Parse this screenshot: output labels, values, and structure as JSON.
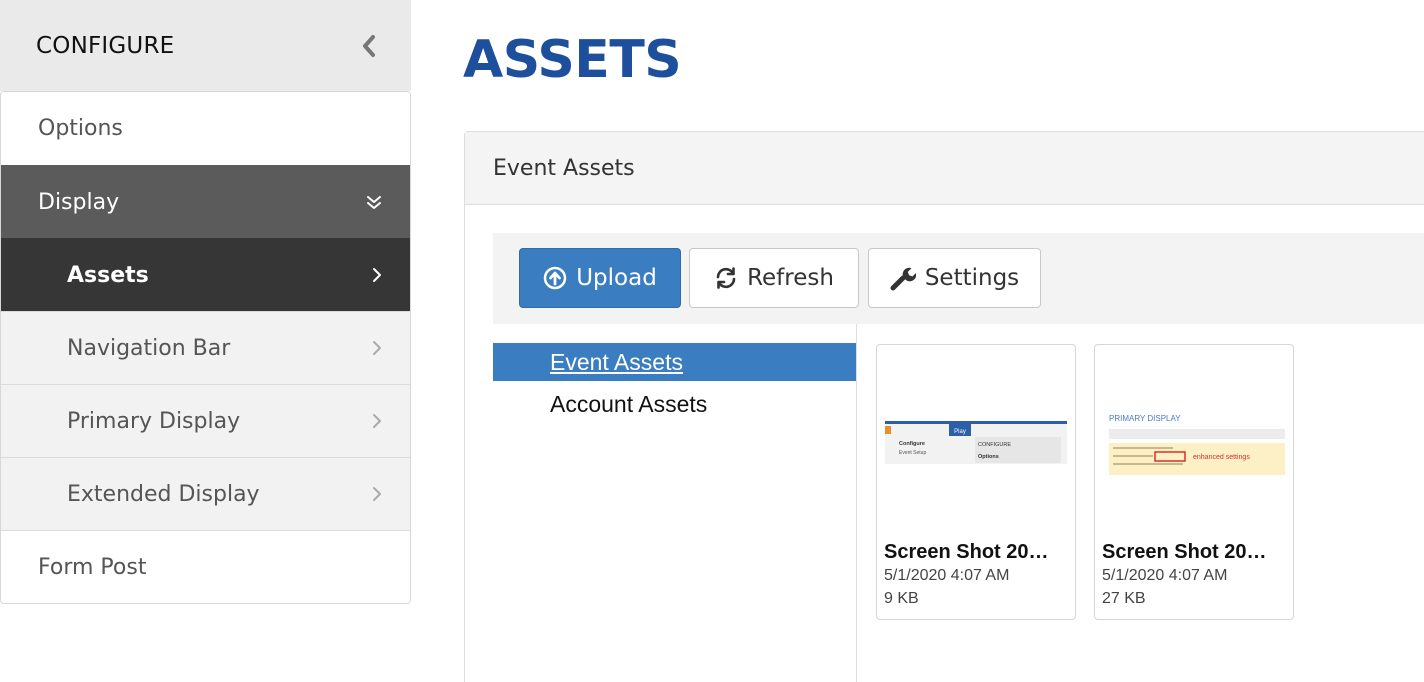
{
  "sidebar": {
    "title": "CONFIGURE",
    "items": [
      {
        "label": "Options"
      },
      {
        "label": "Display"
      },
      {
        "label": "Assets"
      },
      {
        "label": "Navigation Bar"
      },
      {
        "label": "Primary Display"
      },
      {
        "label": "Extended Display"
      },
      {
        "label": "Form Post"
      }
    ]
  },
  "main": {
    "title": "ASSETS",
    "panel_title": "Event Assets",
    "toolbar": {
      "upload_label": "Upload",
      "refresh_label": "Refresh",
      "settings_label": "Settings"
    },
    "tree": [
      {
        "label": "Event Assets",
        "selected": true
      },
      {
        "label": "Account Assets",
        "selected": false
      }
    ],
    "files": [
      {
        "name": "Screen Shot 20…",
        "date": "5/1/2020 4:07 AM",
        "size": "9 KB",
        "thumb": {
          "btn": "Play",
          "menu1": "Configure",
          "menu2": "Event Setup",
          "head": "CONFIGURE",
          "opt": "Options"
        }
      },
      {
        "name": "Screen Shot 20…",
        "date": "5/1/2020 4:07 AM",
        "size": "27 KB",
        "thumb": {
          "title": "PRIMARY DISPLAY",
          "note": "enhanced settings"
        }
      }
    ]
  },
  "colors": {
    "accent": "#3a7dc0",
    "title": "#1e4f9c",
    "sidebar_active": "#5b5b5b",
    "sidebar_selected": "#363636"
  },
  "icons": {
    "collapse": "chevron-left-icon",
    "expanded": "double-chevron-down-icon",
    "submenu": "chevron-right-icon",
    "upload": "circle-arrow-up-icon",
    "refresh": "refresh-icon",
    "settings": "wrench-icon"
  }
}
